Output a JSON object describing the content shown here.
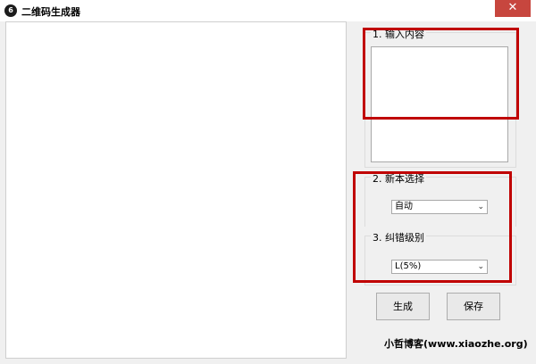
{
  "window": {
    "title": "二维码生成器",
    "app_icon_glyph": "6",
    "close_glyph": "✕"
  },
  "panel": {
    "content_group_label": "1. 输入内容",
    "content_value": "",
    "version_group_label": "2. 新本选择",
    "version_selected": "自动",
    "level_group_label": "3. 纠错级别",
    "level_selected": "L(5%)",
    "chevron_glyph": "⌄"
  },
  "buttons": {
    "generate_label": "生成",
    "save_label": "保存"
  },
  "footer": {
    "credit": "小哲博客(www.xiaozhe.org)"
  },
  "colors": {
    "highlight": "#c00000",
    "close_button": "#c7463e"
  }
}
